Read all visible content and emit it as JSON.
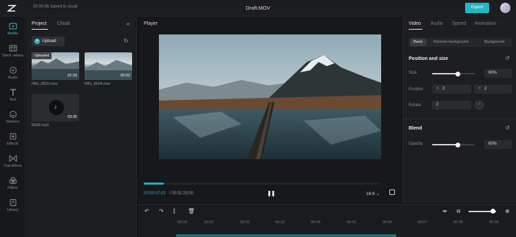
{
  "topbar": {
    "save_status": "20:00:06 Saved in cloud",
    "file_title": "Draft.MOV",
    "export_label": "Export"
  },
  "rail": {
    "items": [
      {
        "label": "Media",
        "icon": "media-icon"
      },
      {
        "label": "Stock videos",
        "icon": "stock-videos-icon"
      },
      {
        "label": "Audio",
        "icon": "audio-icon"
      },
      {
        "label": "Text",
        "icon": "text-icon"
      },
      {
        "label": "Stickers",
        "icon": "stickers-icon"
      },
      {
        "label": "Effects",
        "icon": "effects-icon"
      },
      {
        "label": "Transitions",
        "icon": "transitions-icon"
      },
      {
        "label": "Filters",
        "icon": "filters-icon"
      },
      {
        "label": "Library",
        "icon": "library-icon"
      }
    ]
  },
  "media": {
    "tabs": [
      "Project",
      "Cloud"
    ],
    "upload_label": "Upload",
    "items": [
      {
        "name": "IMG_6502.mov",
        "duration": "01:33",
        "badge": "Uploaded"
      },
      {
        "name": "IMG_6504.mov",
        "duration": "00:52"
      },
      {
        "name": "BGM.mp3",
        "duration": "03:35"
      }
    ]
  },
  "player": {
    "title": "Player",
    "current_time": "00:00:07:02",
    "total_time": "/ 00:01:23:00",
    "progress": 0.085,
    "ratio": "16:9"
  },
  "props": {
    "tabs": [
      "Video",
      "Audio",
      "Speed",
      "Animation"
    ],
    "sub_tabs": [
      "Basic",
      "Remove background",
      "Background"
    ],
    "position_section": "Position and size",
    "size_label": "Size",
    "size_value": "60%",
    "size_level": 0.6,
    "position_label": "Position",
    "pos_x_axis": "X",
    "pos_x": "2",
    "pos_y_axis": "Y",
    "pos_y": "2",
    "rotate_label": "Rotate",
    "rotate_value": "2",
    "blend_section": "Blend",
    "opacity_label": "Opacity",
    "opacity_value": "60%",
    "opacity_level": 0.6
  },
  "timeline": {
    "ticks": [
      "00:00",
      "00:01",
      "00:02",
      "00:03",
      "00:04",
      "00:05",
      "00:06",
      "00:07",
      "00:08",
      "00:09"
    ]
  }
}
